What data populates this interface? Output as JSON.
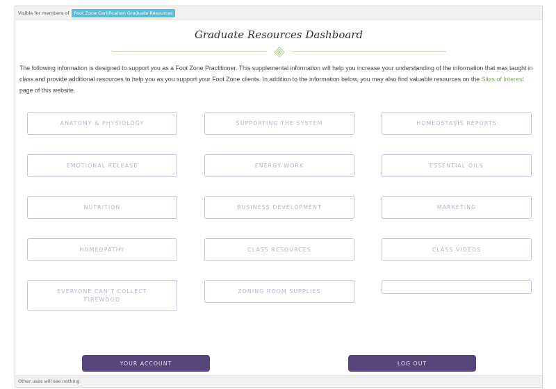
{
  "visibility_bar": {
    "label": "Visible for members of",
    "group": "Foot Zone Certification Graduate Resources"
  },
  "header": {
    "title": "Graduate Resources Dashboard",
    "ornament_icon": "floral-ornament-icon"
  },
  "intro": {
    "text_before_link": "The following information is designed to support you as a Foot Zone Practitioner. This supplemental information will help you increase your understanding of the information that was taught in class and provide additional resources to help you as you support your Foot Zone clients.  In addition to the information below, you may also find valuable resources on the ",
    "link_text": "Sites of Interest",
    "text_after_link": " page of this website."
  },
  "resources": [
    {
      "label": "ANATOMY & PHYSIOLOGY"
    },
    {
      "label": "SUPPORTING THE SYSTEM"
    },
    {
      "label": "HOMEOSTASIS REPORTS"
    },
    {
      "label": "EMOTIONAL RELEASE"
    },
    {
      "label": "ENERGY WORK"
    },
    {
      "label": "ESSENTIAL OILS"
    },
    {
      "label": "NUTRITION"
    },
    {
      "label": "BUSINESS DEVELOPMENT"
    },
    {
      "label": "MARKETING"
    },
    {
      "label": "HOMEOPATHY"
    },
    {
      "label": "CLASS RESOURCES"
    },
    {
      "label": "CLASS VIDEOS"
    },
    {
      "label": "EVERYONE CAN'T COLLECT FIREWOOD"
    },
    {
      "label": "ZONING ROOM SUPPLIES"
    },
    {
      "label": ""
    }
  ],
  "actions": {
    "account_label": "YOUR ACCOUNT",
    "logout_label": "LOG OUT"
  },
  "footer": {
    "text": "Other uses will see nothing"
  },
  "colors": {
    "badge": "#5bbcd3",
    "button_border": "#c6c2dc",
    "button_text": "#b6b2cc",
    "action_bg": "#56457a",
    "link": "#8da86a"
  }
}
